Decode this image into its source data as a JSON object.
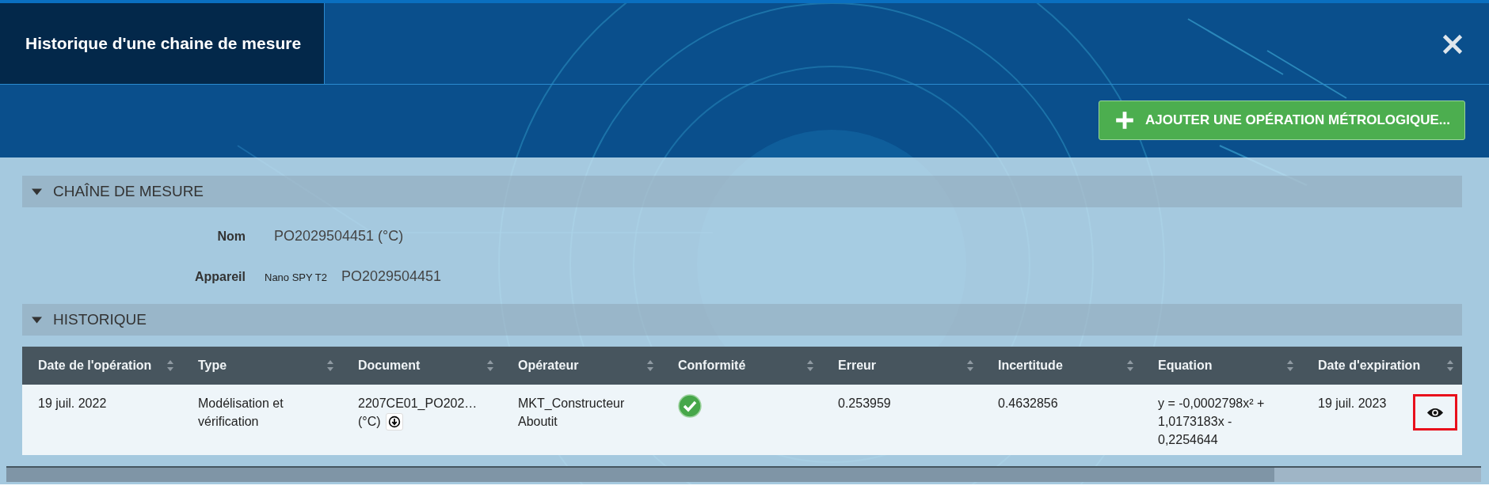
{
  "dialog": {
    "title": "Historique d'une chaine de mesure"
  },
  "add_button": {
    "label": "AJOUTER UNE OPÉRATION MÉTROLOGIQUE..."
  },
  "sections": [
    {
      "title": "CHAÎNE DE MESURE",
      "expanded": true
    },
    {
      "title": "HISTORIQUE",
      "expanded": true
    }
  ],
  "fields": [
    {
      "label": "Nom",
      "value": "PO2029504451 (°C)"
    },
    {
      "label": "Appareil",
      "model": "Nano SPY T2",
      "value": "PO2029504451"
    }
  ],
  "table": {
    "columns": [
      {
        "label": "Date de l'opération",
        "sortable": true
      },
      {
        "label": "Type",
        "sortable": true
      },
      {
        "label": "Document",
        "sortable": true
      },
      {
        "label": "Opérateur",
        "sortable": true
      },
      {
        "label": "Conformité",
        "sortable": true
      },
      {
        "label": "Erreur",
        "sortable": true
      },
      {
        "label": "Incertitude",
        "sortable": true
      },
      {
        "label": "Equation",
        "sortable": true
      },
      {
        "label": "Date d'expiration",
        "sortable": true
      }
    ],
    "rows": [
      {
        "date": "19 juil. 2022",
        "type": "Modélisation et vérification",
        "document": "2207CE01_PO202…",
        "document_unit": "(°C)",
        "operator": "MKT_Constructeur Aboutit",
        "conform": true,
        "error": "0.253959",
        "uncertainty": "0.4632856",
        "equation": "y = -0,0002798x² + 1,0173183x - 0,2254644",
        "expiration": "19 juil. 2023",
        "view_highlighted": true
      }
    ]
  }
}
